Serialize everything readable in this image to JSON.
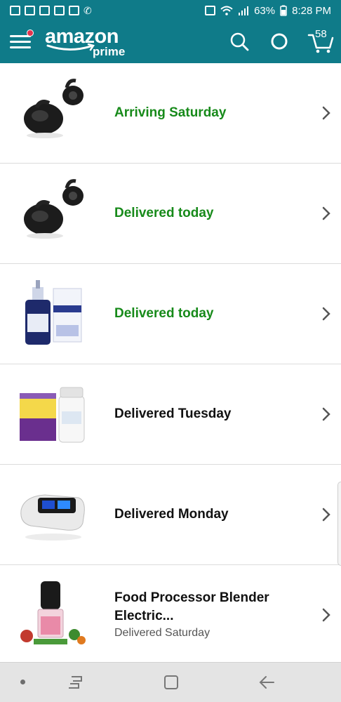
{
  "status_bar": {
    "battery": "63%",
    "time": "8:28 PM"
  },
  "header": {
    "logo_word": "amazon",
    "logo_sub": "prime",
    "cart_count": "58"
  },
  "orders": [
    {
      "status": "Arriving Saturday",
      "status_color": "#178a1a",
      "product_icon": "earbuds-icon"
    },
    {
      "status": "Delivered today",
      "status_color": "#178a1a",
      "product_icon": "earbuds-icon"
    },
    {
      "status": "Delivered today",
      "status_color": "#178a1a",
      "product_icon": "serum-bottle-icon"
    },
    {
      "status": "Delivered Tuesday",
      "status_color": "#111111",
      "product_icon": "supplement-box-icon"
    },
    {
      "status": "Delivered Monday",
      "status_color": "#111111",
      "product_icon": "pulse-oximeter-icon"
    },
    {
      "title": "Food Processor Blender Electric...",
      "status": "Delivered Saturday",
      "status_color": "#555555",
      "product_icon": "food-processor-icon"
    }
  ],
  "colors": {
    "brand_teal": "#0f7b89",
    "delivered_green": "#178a1a"
  }
}
